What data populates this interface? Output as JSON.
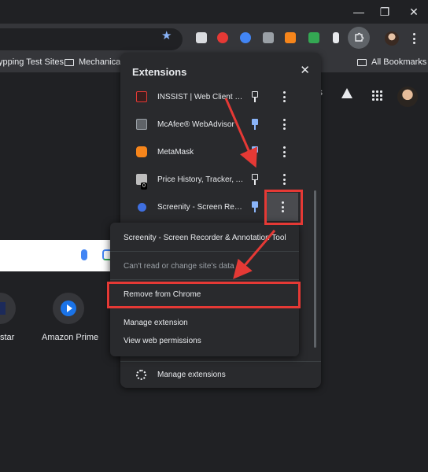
{
  "window": {
    "minimize_icon": "minimize-icon",
    "maximize_icon": "restore-icon",
    "close_icon": "close-icon"
  },
  "toolbar": {
    "bookmark_star_icon": "star-icon",
    "extensions_icon": "puzzle-icon",
    "menu_icon": "kebab-icon"
  },
  "bookmarks": {
    "items": [
      {
        "label": "ypping Test Sites",
        "icon": ""
      },
      {
        "label": "Mechanical",
        "icon": "folder-icon"
      }
    ],
    "all_bookmarks": "All Bookmarks"
  },
  "ntp": {
    "topright_fragment": "s",
    "shortcuts": [
      {
        "label": "star"
      },
      {
        "label": "Amazon Prime"
      }
    ]
  },
  "extensions_panel": {
    "title": "Extensions",
    "items": [
      {
        "name": "INSSIST | Web Client for...",
        "pinned": false,
        "icon_color": "#e53935"
      },
      {
        "name": "McAfee® WebAdvisor",
        "pinned": true,
        "icon_color": "#9aa0a6"
      },
      {
        "name": "MetaMask",
        "pinned": true,
        "icon_color": "#f6851b"
      },
      {
        "name": "Price History, Tracker, A...",
        "pinned": false,
        "icon_color": "#bdbdbd",
        "badge": "0"
      },
      {
        "name": "Screenity - Screen Reco...",
        "pinned": true,
        "icon_color": "#3f6fe0"
      }
    ],
    "manage_label": "Manage extensions"
  },
  "context_menu": {
    "header": "Screenity - Screen Recorder & Annotation Tool",
    "site_access": "Can't read or change site's data",
    "remove": "Remove from Chrome",
    "manage": "Manage extension",
    "permissions": "View web permissions"
  },
  "colors": {
    "annotation_red": "#e53935",
    "pin_blue": "#8ab4f8",
    "panel_bg": "#292a2d"
  }
}
